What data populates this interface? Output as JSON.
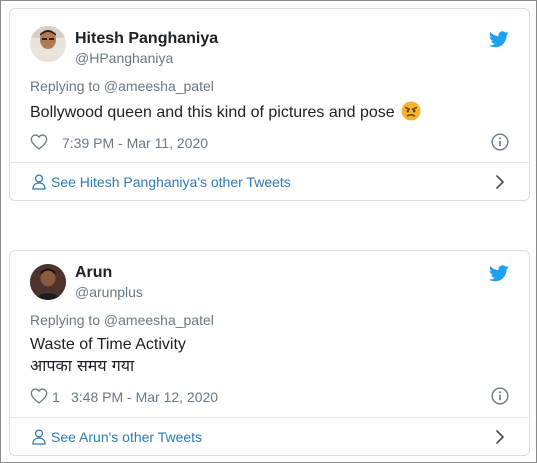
{
  "tweets": [
    {
      "name": "Hitesh Panghaniya",
      "handle": "@HPanghaniya",
      "replying_to": "Replying to @ameesha_patel",
      "text_lines": [
        "Bollywood queen and this kind of pictures and pose"
      ],
      "emoji": "angry-face",
      "likes": "",
      "timestamp": "7:39 PM - Mar 11, 2020",
      "footer_link": "See Hitesh Panghaniya's other Tweets"
    },
    {
      "name": "Arun",
      "handle": "@arunplus",
      "replying_to": "Replying to @ameesha_patel",
      "text_lines": [
        "Waste of Time Activity",
        "आपका समय गया"
      ],
      "likes": "1",
      "timestamp": "3:48 PM - Mar 12, 2020",
      "footer_link": "See Arun's other Tweets"
    }
  ],
  "colors": {
    "twitter_blue": "#1da1f2",
    "link": "#2b7bb9",
    "muted": "#697882",
    "border": "#d8dee2"
  },
  "icons": [
    "twitter-bird-icon",
    "heart-icon",
    "info-icon",
    "person-icon",
    "chevron-right-icon",
    "angry-face-emoji"
  ]
}
